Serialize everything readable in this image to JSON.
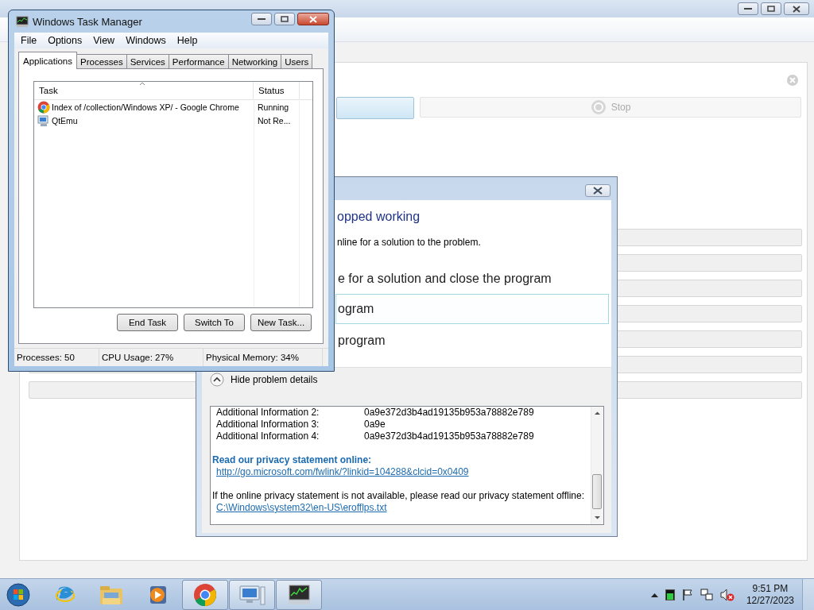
{
  "background_window": {
    "stop_button": {
      "label": "Stop",
      "disabled": true
    }
  },
  "error_dialog": {
    "heading": "opped working",
    "description": "nline for a solution to the problem.",
    "options": [
      {
        "label": "e for a solution and close the program",
        "selected": false
      },
      {
        "label": "ogram",
        "selected": true
      },
      {
        "label": "program",
        "selected": false
      }
    ],
    "details_toggle": {
      "label": "Hide problem details",
      "expanded": true
    },
    "details": {
      "rows": [
        {
          "label": "Additional Information 2:",
          "value": "0a9e372d3b4ad19135b953a78882e789"
        },
        {
          "label": "Additional Information 3:",
          "value": "0a9e"
        },
        {
          "label": "Additional Information 4:",
          "value": "0a9e372d3b4ad19135b953a78882e789"
        }
      ],
      "privacy_heading": "Read our privacy statement online:",
      "privacy_link": "http://go.microsoft.com/fwlink/?linkid=104288&clcid=0x0409",
      "offline_note": "If the online privacy statement is not available, please read our privacy statement offline:",
      "offline_link": "C:\\Windows\\system32\\en-US\\erofflps.txt"
    }
  },
  "task_manager": {
    "title": "Windows Task Manager",
    "menu": [
      "File",
      "Options",
      "View",
      "Windows",
      "Help"
    ],
    "tabs": [
      {
        "label": "Applications",
        "selected": true
      },
      {
        "label": "Processes",
        "selected": false
      },
      {
        "label": "Services",
        "selected": false
      },
      {
        "label": "Performance",
        "selected": false
      },
      {
        "label": "Networking",
        "selected": false
      },
      {
        "label": "Users",
        "selected": false
      }
    ],
    "columns": [
      "Task",
      "Status"
    ],
    "rows": [
      {
        "task": "Index of /collection/Windows XP/ - Google Chrome",
        "status": "Running"
      },
      {
        "task": "QtEmu",
        "status": "Not Re..."
      }
    ],
    "buttons": [
      "End Task",
      "Switch To",
      "New Task..."
    ],
    "status_bar": [
      "Processes: 50",
      "CPU Usage: 27%",
      "Physical Memory: 34%"
    ]
  },
  "taskbar": {
    "items": [
      {
        "open": false
      },
      {
        "open": false
      },
      {
        "open": false
      },
      {
        "open": true
      },
      {
        "open": true
      },
      {
        "open": true
      }
    ],
    "clock": {
      "time": "9:51 PM",
      "date": "12/27/2023"
    }
  }
}
